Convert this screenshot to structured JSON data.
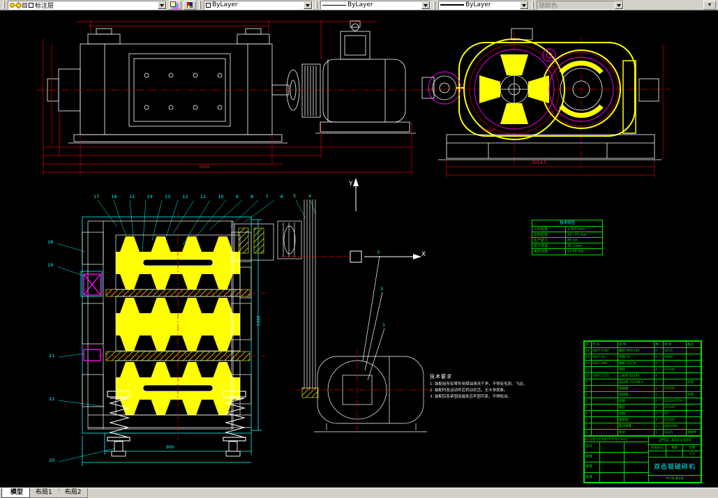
{
  "toolbar": {
    "layer_combo": "标注层",
    "color_combo": "ByLayer",
    "linetype_combo": "ByLayer",
    "lineweight_combo": "ByLayer",
    "plotstyle_combo": "随颜色"
  },
  "tabs": {
    "model": "模型",
    "layout1": "布局1",
    "layout2": "布局2"
  },
  "drawing": {
    "axis": {
      "x": "X",
      "y": "Y"
    },
    "dims": {
      "overall_length": "1500",
      "base_width": "2014.5",
      "roller_width": "900",
      "frame_height": "1320",
      "roller_dia": "Φ650"
    },
    "callouts": {
      "top": [
        "17",
        "16",
        "15",
        "14",
        "13",
        "12",
        "11",
        "10",
        "9",
        "8",
        "7",
        "6"
      ],
      "right": [
        "5",
        "4"
      ],
      "motor": [
        "3",
        "2",
        "1"
      ],
      "left": [
        "18",
        "19",
        "21",
        "22",
        "20"
      ]
    },
    "notes": {
      "title": "技术要求",
      "lines": [
        "1. 装配前所有零件用煤油清洗干净，不得有毛刺、飞边。",
        "2. 装配时各运动件应转动灵活，无卡滞现象。",
        "3. 装配后各紧固连接处应牢固可靠，不得松动。"
      ]
    }
  },
  "spec_table": {
    "title": "技术特性",
    "rows": [
      {
        "name": "入料粒度",
        "value": "≤300 mm"
      },
      {
        "name": "出料粒度",
        "value": "25~75 mm"
      },
      {
        "name": "生产能力",
        "value": "85 t/h"
      },
      {
        "name": "辊子转速",
        "value": "45 r/min"
      },
      {
        "name": "电机功率",
        "value": "2×55 kW"
      }
    ]
  },
  "title_block": {
    "bom_headers": {
      "no": "序",
      "code": "代 号",
      "name": "名 称",
      "qty": "数",
      "mat": "材 料",
      "note": "备注"
    },
    "bom": [
      {
        "no": "14",
        "code": "GB/T 5782",
        "name": "螺栓 M16×60",
        "qty": "8",
        "mat": "Q235",
        "note": ""
      },
      {
        "no": "13",
        "code": "GB/T 93",
        "name": "垫圈 16",
        "qty": "8",
        "mat": "65Mn",
        "note": ""
      },
      {
        "no": "12",
        "code": "GB/T 288",
        "name": "轴承 22218",
        "qty": "4",
        "mat": "",
        "note": ""
      },
      {
        "no": "11",
        "code": "",
        "name": "带轮",
        "qty": "1",
        "mat": "HT200",
        "note": ""
      },
      {
        "no": "10",
        "code": "GB/T 1171",
        "name": "三角带 B2240",
        "qty": "4",
        "mat": "",
        "note": ""
      },
      {
        "no": "9",
        "code": "",
        "name": "电动机 Y225M-4",
        "qty": "1",
        "mat": "",
        "note": "外购"
      },
      {
        "no": "8",
        "code": "",
        "name": "联轴器",
        "qty": "1",
        "mat": "HT200",
        "note": ""
      },
      {
        "no": "7",
        "code": "",
        "name": "减速器",
        "qty": "1",
        "mat": "",
        "note": "外购"
      },
      {
        "no": "6",
        "code": "",
        "name": "齿圈",
        "qty": "2",
        "mat": "ZG310-570",
        "note": ""
      },
      {
        "no": "5",
        "code": "",
        "name": "辊芯",
        "qty": "2",
        "mat": "HT200",
        "note": ""
      },
      {
        "no": "4",
        "code": "",
        "name": "主轴",
        "qty": "2",
        "mat": "45",
        "note": ""
      },
      {
        "no": "3",
        "code": "",
        "name": "轴承座",
        "qty": "4",
        "mat": "HT200",
        "note": ""
      },
      {
        "no": "2",
        "code": "",
        "name": "缓冲弹簧",
        "qty": "4",
        "mat": "60Si2Mn",
        "note": ""
      },
      {
        "no": "1",
        "code": "",
        "name": "机架",
        "qty": "1",
        "mat": "Q235",
        "note": "焊接件"
      }
    ],
    "sign_note": "标记 处数 分区 更改文件号 签名 年月日",
    "sign_rows": [
      {
        "label": "设计"
      },
      {
        "label": "校核"
      },
      {
        "label": "审核"
      },
      {
        "label": "批准"
      }
    ],
    "drawing_no": "2PGC-450×500",
    "stage_label": "阶段标记",
    "weight_label": "重量",
    "scale_label": "比例",
    "scale": "1:5",
    "title": "双齿辊破碎机",
    "sheet": "共1张 第1张"
  }
}
